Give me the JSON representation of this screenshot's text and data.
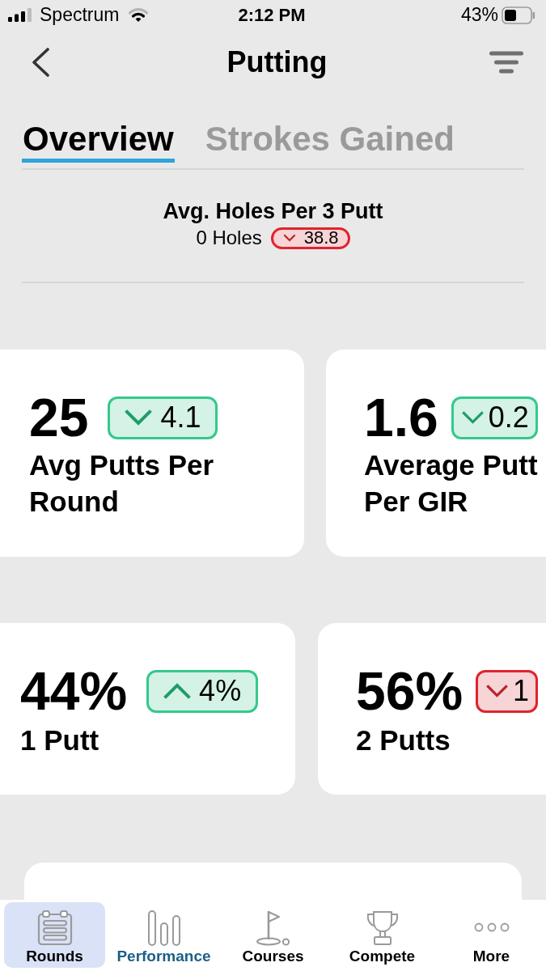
{
  "status_bar": {
    "carrier": "Spectrum",
    "time": "2:12 PM",
    "battery": "43%"
  },
  "header": {
    "title": "Putting"
  },
  "tabs": [
    {
      "label": "Overview",
      "selected": true
    },
    {
      "label": "Strokes Gained",
      "selected": false
    }
  ],
  "summary": {
    "title": "Avg. Holes Per 3 Putt",
    "value": "0 Holes",
    "change": {
      "value": "38.8",
      "rising": false,
      "favorable": false
    }
  },
  "card_rows": [
    {
      "cards": [
        {
          "value": "25",
          "change": {
            "value": "4.1",
            "rising": false,
            "favorable": true
          },
          "label": "Avg Putts Per Round"
        },
        {
          "value": "1.6",
          "change": {
            "value": "0.2",
            "rising": false,
            "favorable": true
          },
          "label": "Average Putt Per GIR"
        }
      ]
    },
    {
      "cards": [
        {
          "value": "44%",
          "change": {
            "value": "4%",
            "rising": true,
            "favorable": true
          },
          "label": "1 Putt"
        },
        {
          "value": "56%",
          "change": {
            "value": "1",
            "rising": false,
            "favorable": false
          },
          "label": "2 Putts"
        }
      ]
    }
  ],
  "tab_bar": [
    {
      "label": "Rounds",
      "selected": false,
      "highlighted": true
    },
    {
      "label": "Performance",
      "selected": true,
      "highlighted": false
    },
    {
      "label": "Courses",
      "selected": false,
      "highlighted": false
    },
    {
      "label": "Compete",
      "selected": false,
      "highlighted": false
    },
    {
      "label": "More",
      "selected": false,
      "highlighted": false
    }
  ]
}
